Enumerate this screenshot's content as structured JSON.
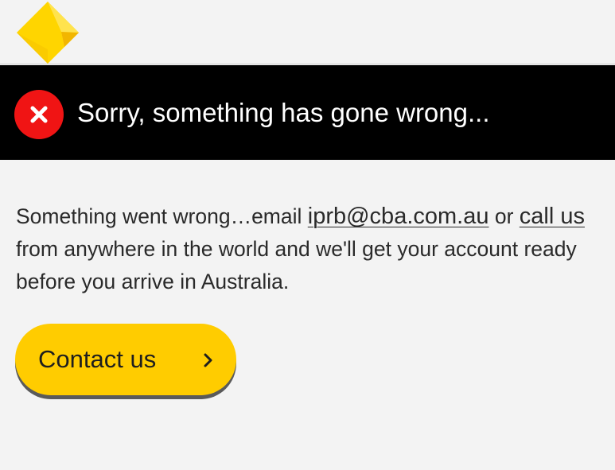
{
  "header": {
    "logo_icon": "commbank-diamond-logo",
    "logo_color": "#ffcc00"
  },
  "error_banner": {
    "icon": "error-x-icon",
    "icon_color": "#f01414",
    "title": "Sorry, something has gone wrong..."
  },
  "message": {
    "text_before_email": "Something went wrong…email ",
    "email_link": "iprb@cba.com.au",
    "text_between": " or ",
    "call_link": "call us",
    "text_after": " from anywhere in the world and we'll get your account ready before you arrive in Australia."
  },
  "contact_button": {
    "label": "Contact us",
    "icon": "chevron-right-icon",
    "color": "#ffcc00"
  }
}
